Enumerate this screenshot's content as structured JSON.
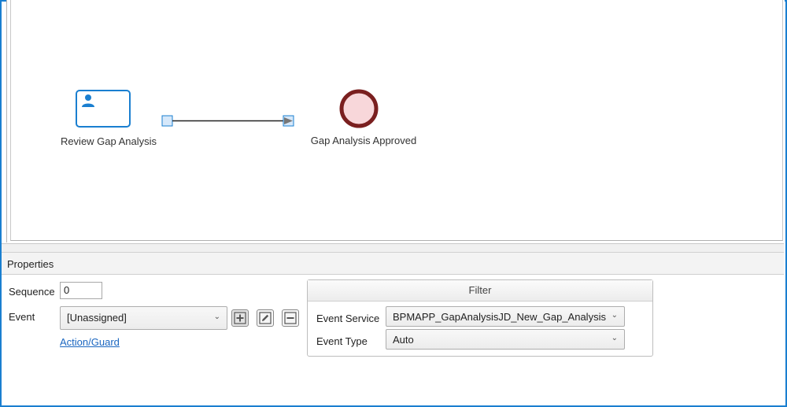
{
  "canvas": {
    "task": {
      "label": "Review Gap Analysis",
      "icon": "user-icon"
    },
    "end_event": {
      "label": "Gap Analysis Approved",
      "icon": "end-event-circle"
    },
    "colors": {
      "accent": "#1a7fd0",
      "end_stroke": "#7a1f1f",
      "end_fill": "#f8d7da"
    }
  },
  "properties": {
    "title": "Properties",
    "sequence_label": "Sequence",
    "sequence_value": "0",
    "event_label": "Event",
    "event_value": "[Unassigned]",
    "buttons": {
      "add": "plus-icon",
      "edit": "pencil-icon",
      "remove": "minus-icon"
    },
    "action_guard_link": "Action/Guard",
    "filter": {
      "title": "Filter",
      "event_service_label": "Event Service",
      "event_service_value": "BPMAPP_GapAnalysisJD_New_Gap_Analysis",
      "event_type_label": "Event Type",
      "event_type_value": "Auto"
    }
  }
}
